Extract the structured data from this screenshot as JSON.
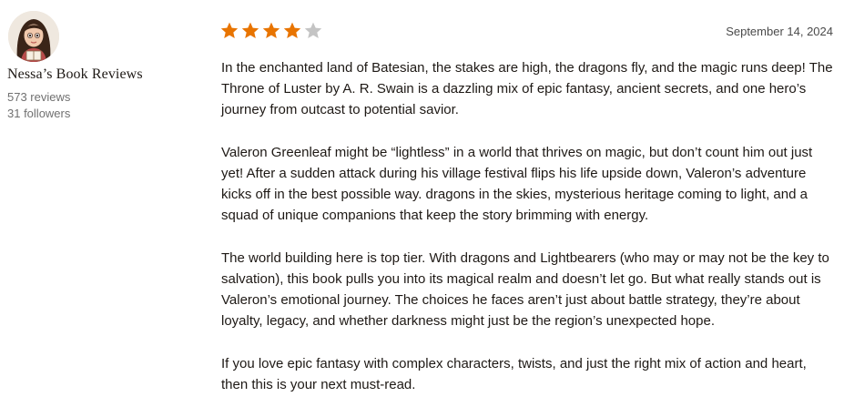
{
  "reviewer": {
    "name": "Nessa’s Book Reviews",
    "reviews_count": "573 reviews",
    "followers_count": "31 followers",
    "avatar_icon": "reviewer-avatar"
  },
  "review": {
    "rating": 4,
    "rating_max": 5,
    "star_filled_color": "#e87400",
    "star_empty_color": "#c4c4c4",
    "date": "September 14, 2024",
    "paragraphs": [
      "In the enchanted land of Batesian, the stakes are high, the dragons fly, and the magic runs deep! The Throne of Luster by A. R. Swain is a dazzling mix of epic fantasy, ancient secrets, and one hero’s journey from outcast to potential savior.",
      "Valeron Greenleaf might be “lightless” in a world that thrives on magic, but don’t count him out just yet! After a sudden attack during his village festival flips his life upside down, Valeron’s adventure kicks off in the best possible way. dragons in the skies, mysterious heritage coming to light, and a squad of unique companions that keep the story brimming with energy.",
      "The world building here is top tier. With dragons and Lightbearers (who may or may not be the key to salvation), this book pulls you into its magical realm and doesn’t let go. But what really stands out is Valeron’s emotional journey. The choices he faces aren’t just about battle strategy, they’re about loyalty, legacy, and whether darkness might just be the region’s unexpected hope.",
      "If you love epic fantasy with complex characters, twists, and just the right mix of action and heart, then this is your next must-read."
    ]
  }
}
